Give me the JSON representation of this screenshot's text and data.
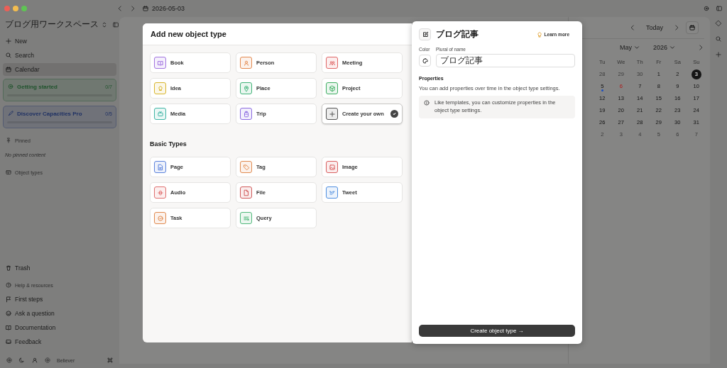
{
  "top_bar": {
    "date": "2026-05-03"
  },
  "sidebar": {
    "workspace": "ブログ用ワークスペース",
    "items": [
      {
        "label": "New",
        "selected": false
      },
      {
        "label": "Search",
        "selected": false
      },
      {
        "label": "Calendar",
        "selected": true
      }
    ],
    "progress_cards": [
      {
        "title": "Getting started",
        "count": "0/7",
        "level": 0,
        "color": "#21542e"
      },
      {
        "title": "Discover Capacities Pro",
        "count": "0/5",
        "level": 0,
        "color": "#203264"
      }
    ],
    "pinned": {
      "heading": "Pinned",
      "empty_text": "No pinned content"
    },
    "object_types": {
      "heading": "Object types"
    },
    "trash": "Trash",
    "help": {
      "heading": "Help & resources",
      "items": [
        "First steps",
        "Ask a question",
        "Documentation",
        "Feedback"
      ]
    },
    "footer": {
      "plan": "Believer"
    }
  },
  "calendar": {
    "today_button": "Today",
    "month": "May",
    "year": "2026",
    "weekdays": [
      "Tu",
      "We",
      "Th",
      "Fr",
      "Sa",
      "Su"
    ],
    "weeks": [
      [
        {
          "day": "28",
          "outside": true,
          "selected": false,
          "today": false,
          "event": false
        },
        {
          "day": "29",
          "outside": true,
          "selected": false,
          "today": false,
          "event": false
        },
        {
          "day": "30",
          "outside": true,
          "selected": false,
          "today": false,
          "event": false
        },
        {
          "day": "1",
          "outside": false,
          "selected": false,
          "today": false,
          "event": false
        },
        {
          "day": "2",
          "outside": false,
          "selected": false,
          "today": false,
          "event": false
        },
        {
          "day": "3",
          "outside": false,
          "selected": true,
          "today": false,
          "event": false
        }
      ],
      [
        {
          "day": "5",
          "outside": false,
          "selected": false,
          "today": false,
          "event": true
        },
        {
          "day": "6",
          "outside": false,
          "selected": false,
          "today": true,
          "event": false
        },
        {
          "day": "7",
          "outside": false,
          "selected": false,
          "today": false,
          "event": false
        },
        {
          "day": "8",
          "outside": false,
          "selected": false,
          "today": false,
          "event": false
        },
        {
          "day": "9",
          "outside": false,
          "selected": false,
          "today": false,
          "event": false
        },
        {
          "day": "10",
          "outside": false,
          "selected": false,
          "today": false,
          "event": false
        }
      ],
      [
        {
          "day": "12",
          "outside": false,
          "selected": false,
          "today": false,
          "event": false
        },
        {
          "day": "13",
          "outside": false,
          "selected": false,
          "today": false,
          "event": false
        },
        {
          "day": "14",
          "outside": false,
          "selected": false,
          "today": false,
          "event": false
        },
        {
          "day": "15",
          "outside": false,
          "selected": false,
          "today": false,
          "event": false
        },
        {
          "day": "16",
          "outside": false,
          "selected": false,
          "today": false,
          "event": false
        },
        {
          "day": "17",
          "outside": false,
          "selected": false,
          "today": false,
          "event": false
        }
      ],
      [
        {
          "day": "19",
          "outside": false,
          "selected": false,
          "today": false,
          "event": false
        },
        {
          "day": "20",
          "outside": false,
          "selected": false,
          "today": false,
          "event": false
        },
        {
          "day": "21",
          "outside": false,
          "selected": false,
          "today": false,
          "event": false
        },
        {
          "day": "22",
          "outside": false,
          "selected": false,
          "today": false,
          "event": false
        },
        {
          "day": "23",
          "outside": false,
          "selected": false,
          "today": false,
          "event": false
        },
        {
          "day": "24",
          "outside": false,
          "selected": false,
          "today": false,
          "event": false
        }
      ],
      [
        {
          "day": "26",
          "outside": false,
          "selected": false,
          "today": false,
          "event": false
        },
        {
          "day": "27",
          "outside": false,
          "selected": false,
          "today": false,
          "event": false
        },
        {
          "day": "28",
          "outside": false,
          "selected": false,
          "today": false,
          "event": false
        },
        {
          "day": "29",
          "outside": false,
          "selected": false,
          "today": false,
          "event": false
        },
        {
          "day": "30",
          "outside": false,
          "selected": false,
          "today": false,
          "event": false
        },
        {
          "day": "31",
          "outside": false,
          "selected": false,
          "today": false,
          "event": false
        }
      ],
      [
        {
          "day": "2",
          "outside": true,
          "selected": false,
          "today": false,
          "event": false
        },
        {
          "day": "3",
          "outside": true,
          "selected": false,
          "today": false,
          "event": false
        },
        {
          "day": "4",
          "outside": true,
          "selected": false,
          "today": false,
          "event": false
        },
        {
          "day": "5",
          "outside": true,
          "selected": false,
          "today": false,
          "event": false
        },
        {
          "day": "6",
          "outside": true,
          "selected": false,
          "today": false,
          "event": false
        },
        {
          "day": "7",
          "outside": true,
          "selected": false,
          "today": false,
          "event": false
        }
      ]
    ]
  },
  "dialog": {
    "title": "Add new object type",
    "types": [
      {
        "label": "Book",
        "color": "#a274e0",
        "selected": false,
        "kind": "type"
      },
      {
        "label": "Person",
        "color": "#e38a4f",
        "selected": false,
        "kind": "type"
      },
      {
        "label": "Meeting",
        "color": "#e06666",
        "selected": false,
        "kind": "type"
      },
      {
        "label": "Idea",
        "color": "#d9b52c",
        "selected": false,
        "kind": "type"
      },
      {
        "label": "Place",
        "color": "#3fb277",
        "selected": false,
        "kind": "type"
      },
      {
        "label": "Project",
        "color": "#3fae62",
        "selected": false,
        "kind": "type"
      },
      {
        "label": "Media",
        "color": "#3fb5a5",
        "selected": false,
        "kind": "type"
      },
      {
        "label": "Trip",
        "color": "#8b6ae0",
        "selected": false,
        "kind": "type"
      },
      {
        "label": "Create your own",
        "color": "#555555",
        "selected": true,
        "kind": "create"
      }
    ],
    "basic_heading": "Basic Types",
    "basic_types": [
      {
        "label": "Page",
        "color": "#5b82dc",
        "selected": false,
        "kind": "type"
      },
      {
        "label": "Tag",
        "color": "#e08a4f",
        "selected": false,
        "kind": "type"
      },
      {
        "label": "Image",
        "color": "#d95f5f",
        "selected": false,
        "kind": "type"
      },
      {
        "label": "Audio",
        "color": "#e07070",
        "selected": false,
        "kind": "type"
      },
      {
        "label": "File",
        "color": "#d05a5a",
        "selected": false,
        "kind": "type"
      },
      {
        "label": "Tweet",
        "color": "#4f8fe0",
        "selected": false,
        "kind": "type"
      },
      {
        "label": "Task",
        "color": "#e08a4f",
        "selected": false,
        "kind": "type"
      },
      {
        "label": "Query",
        "color": "#4fb87a",
        "selected": false,
        "kind": "type"
      }
    ]
  },
  "detail": {
    "title": "ブログ記事",
    "learn_more": "Learn more",
    "color_label": "Color",
    "plural_label": "Plural of name",
    "plural_value": "ブログ記事",
    "properties_heading": "Properties",
    "properties_text": "You can add properties over time in the object type settings.",
    "info_text": "Like templates, you can customize properties in the object type settings.",
    "submit": "Create object type →"
  }
}
